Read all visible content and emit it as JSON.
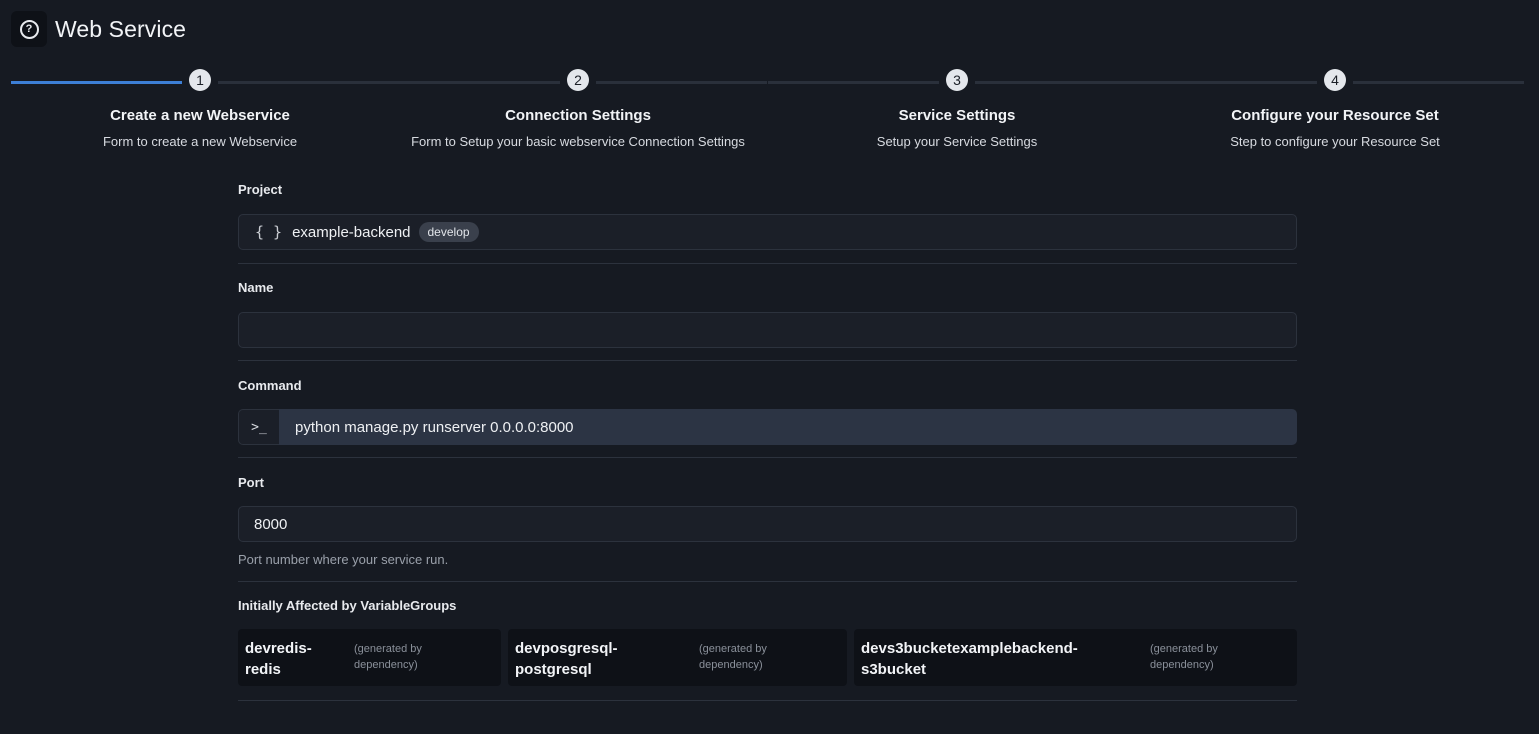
{
  "header": {
    "title": "Web Service",
    "help_icon": "question-circle-icon"
  },
  "stepper": {
    "steps": [
      {
        "number": "1",
        "title": "Create a new Webservice",
        "subtitle": "Form to create a new Webservice",
        "active": true
      },
      {
        "number": "2",
        "title": "Connection Settings",
        "subtitle": "Form to Setup your basic webservice Connection Settings",
        "active": false
      },
      {
        "number": "3",
        "title": "Service Settings",
        "subtitle": "Setup your Service Settings",
        "active": false
      },
      {
        "number": "4",
        "title": "Configure your Resource Set",
        "subtitle": "Step to configure your Resource Set",
        "active": false
      }
    ],
    "accent_color": "#3d7fd6"
  },
  "form": {
    "project": {
      "label": "Project",
      "icon": "{ }",
      "value": "example-backend",
      "badge": "develop"
    },
    "name": {
      "label": "Name",
      "value": ""
    },
    "command": {
      "label": "Command",
      "prefix_icon": "terminal-icon",
      "value": "python manage.py runserver 0.0.0.0:8000"
    },
    "port": {
      "label": "Port",
      "value": "8000",
      "helper": "Port number where your service run."
    },
    "variable_groups": {
      "label": "Initially Affected by VariableGroups",
      "items": [
        {
          "name_line1": "devredis-",
          "name_line2": "redis",
          "note_line1": "(generated by",
          "note_line2": "dependency)"
        },
        {
          "name_line1": "devposgresql-",
          "name_line2": "postgresql",
          "note_line1": "(generated by",
          "note_line2": "dependency)"
        },
        {
          "name_line1": "devs3bucketexamplebackend-",
          "name_line2": "s3bucket",
          "note_line1": "(generated by",
          "note_line2": "dependency)"
        }
      ]
    }
  }
}
